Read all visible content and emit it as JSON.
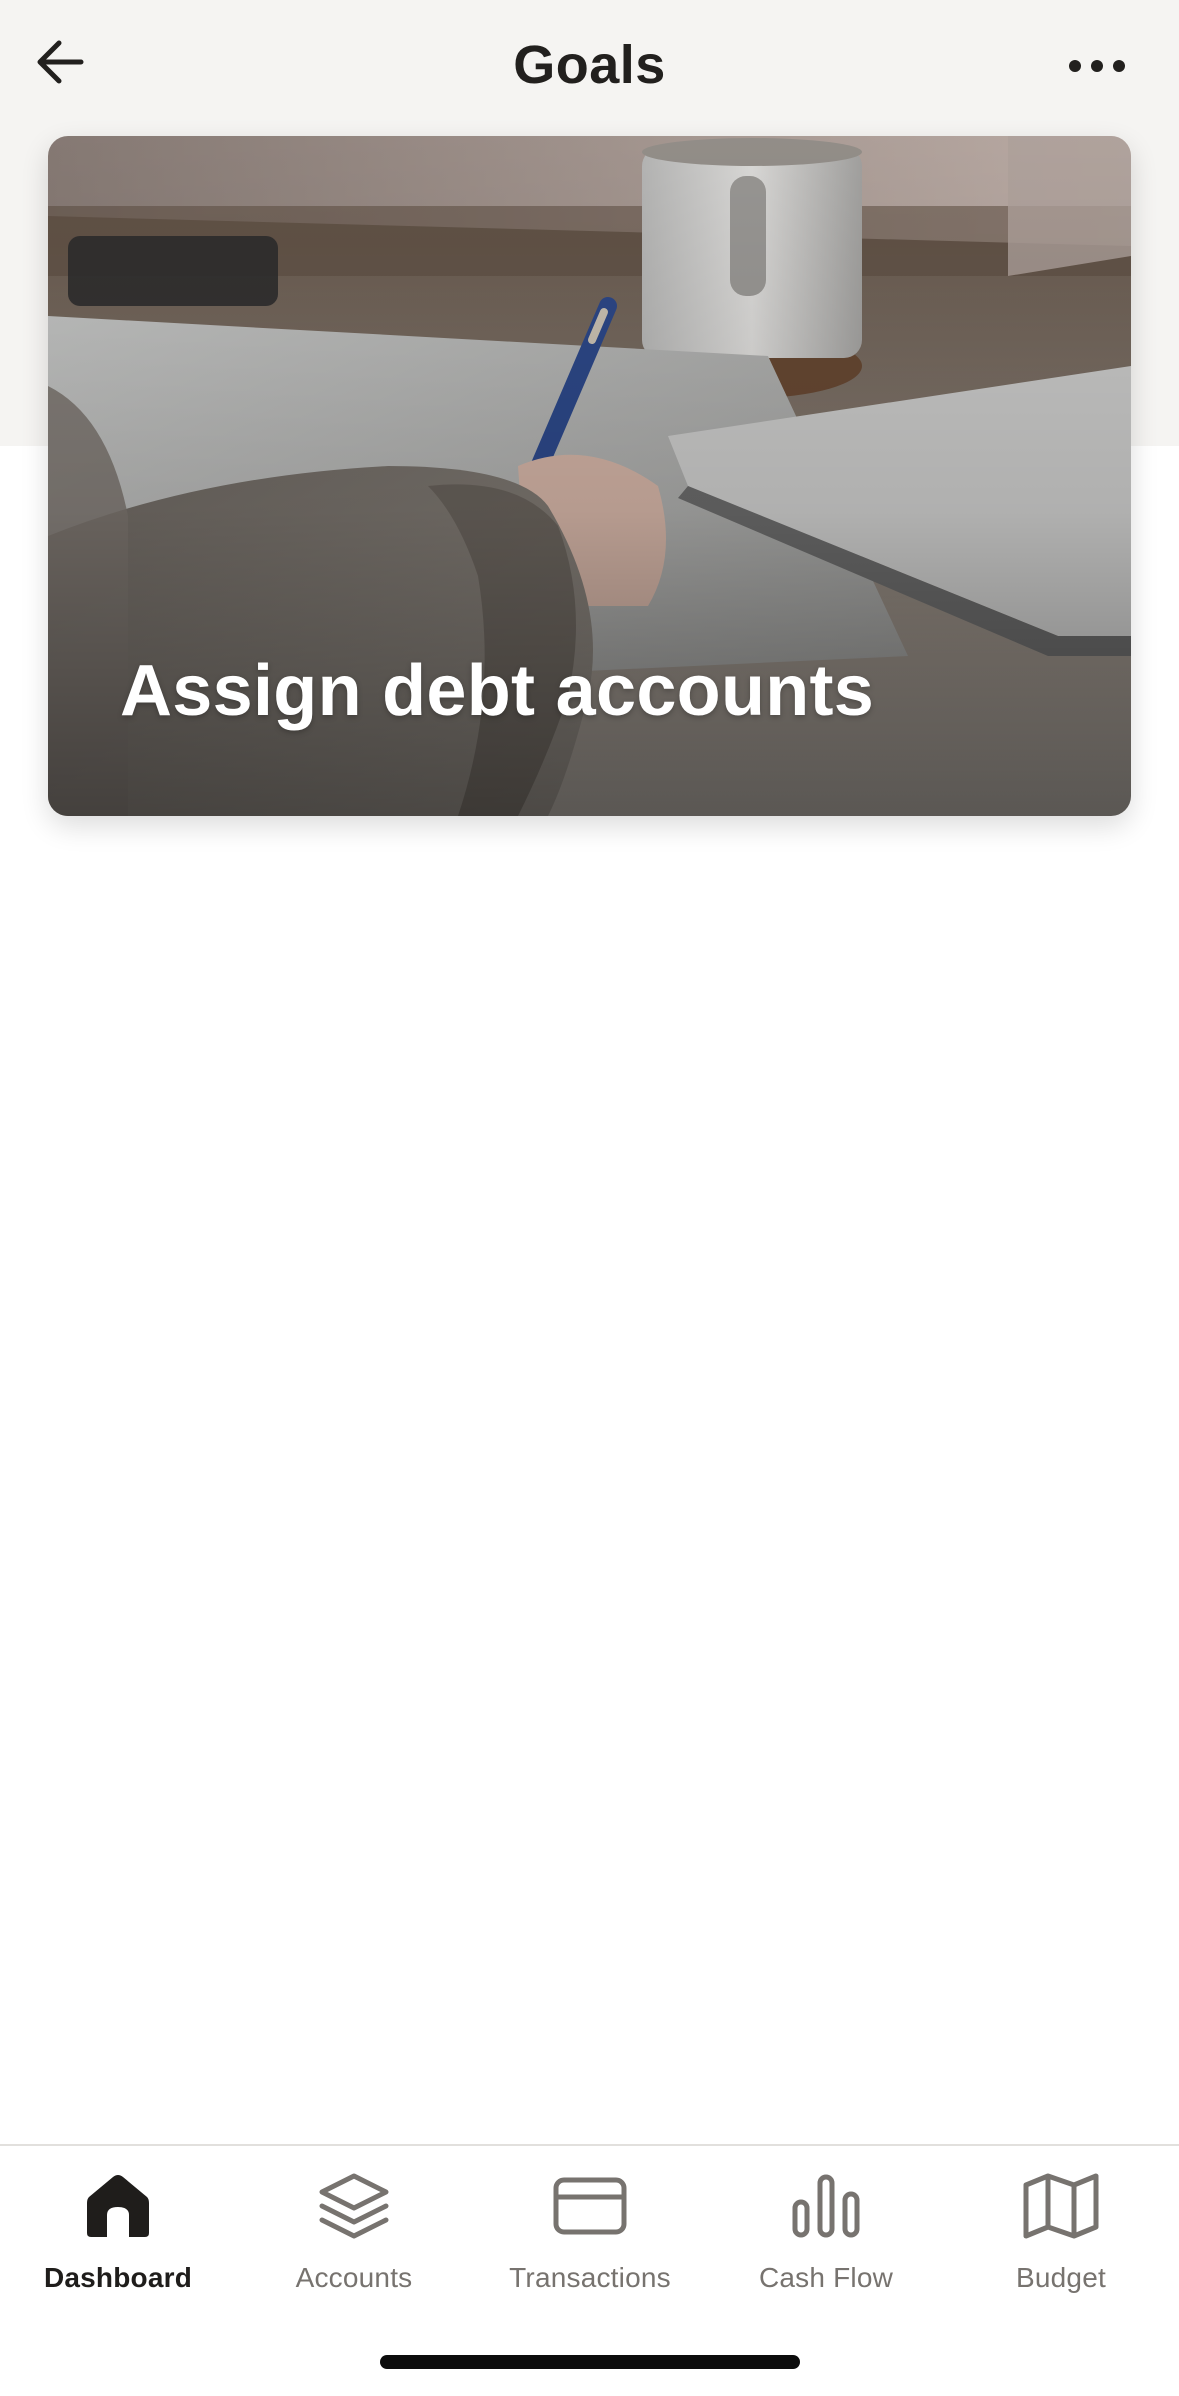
{
  "header": {
    "title": "Goals",
    "back_icon": "arrow-left-icon",
    "more_icon": "ellipsis-icon"
  },
  "goal_card": {
    "title": "Assign debt accounts",
    "image": "person-writing-at-desk-photo"
  },
  "tabbar": {
    "tabs": [
      {
        "label": "Dashboard",
        "icon": "home-icon",
        "active": true
      },
      {
        "label": "Accounts",
        "icon": "layers-icon",
        "active": false
      },
      {
        "label": "Transactions",
        "icon": "credit-card-icon",
        "active": false
      },
      {
        "label": "Cash Flow",
        "icon": "bar-chart-icon",
        "active": false
      },
      {
        "label": "Budget",
        "icon": "map-icon",
        "active": false
      }
    ]
  },
  "colors": {
    "header_bg": "#f5f4f2",
    "text_primary": "#1f1d1b",
    "tab_inactive": "#77736f"
  }
}
